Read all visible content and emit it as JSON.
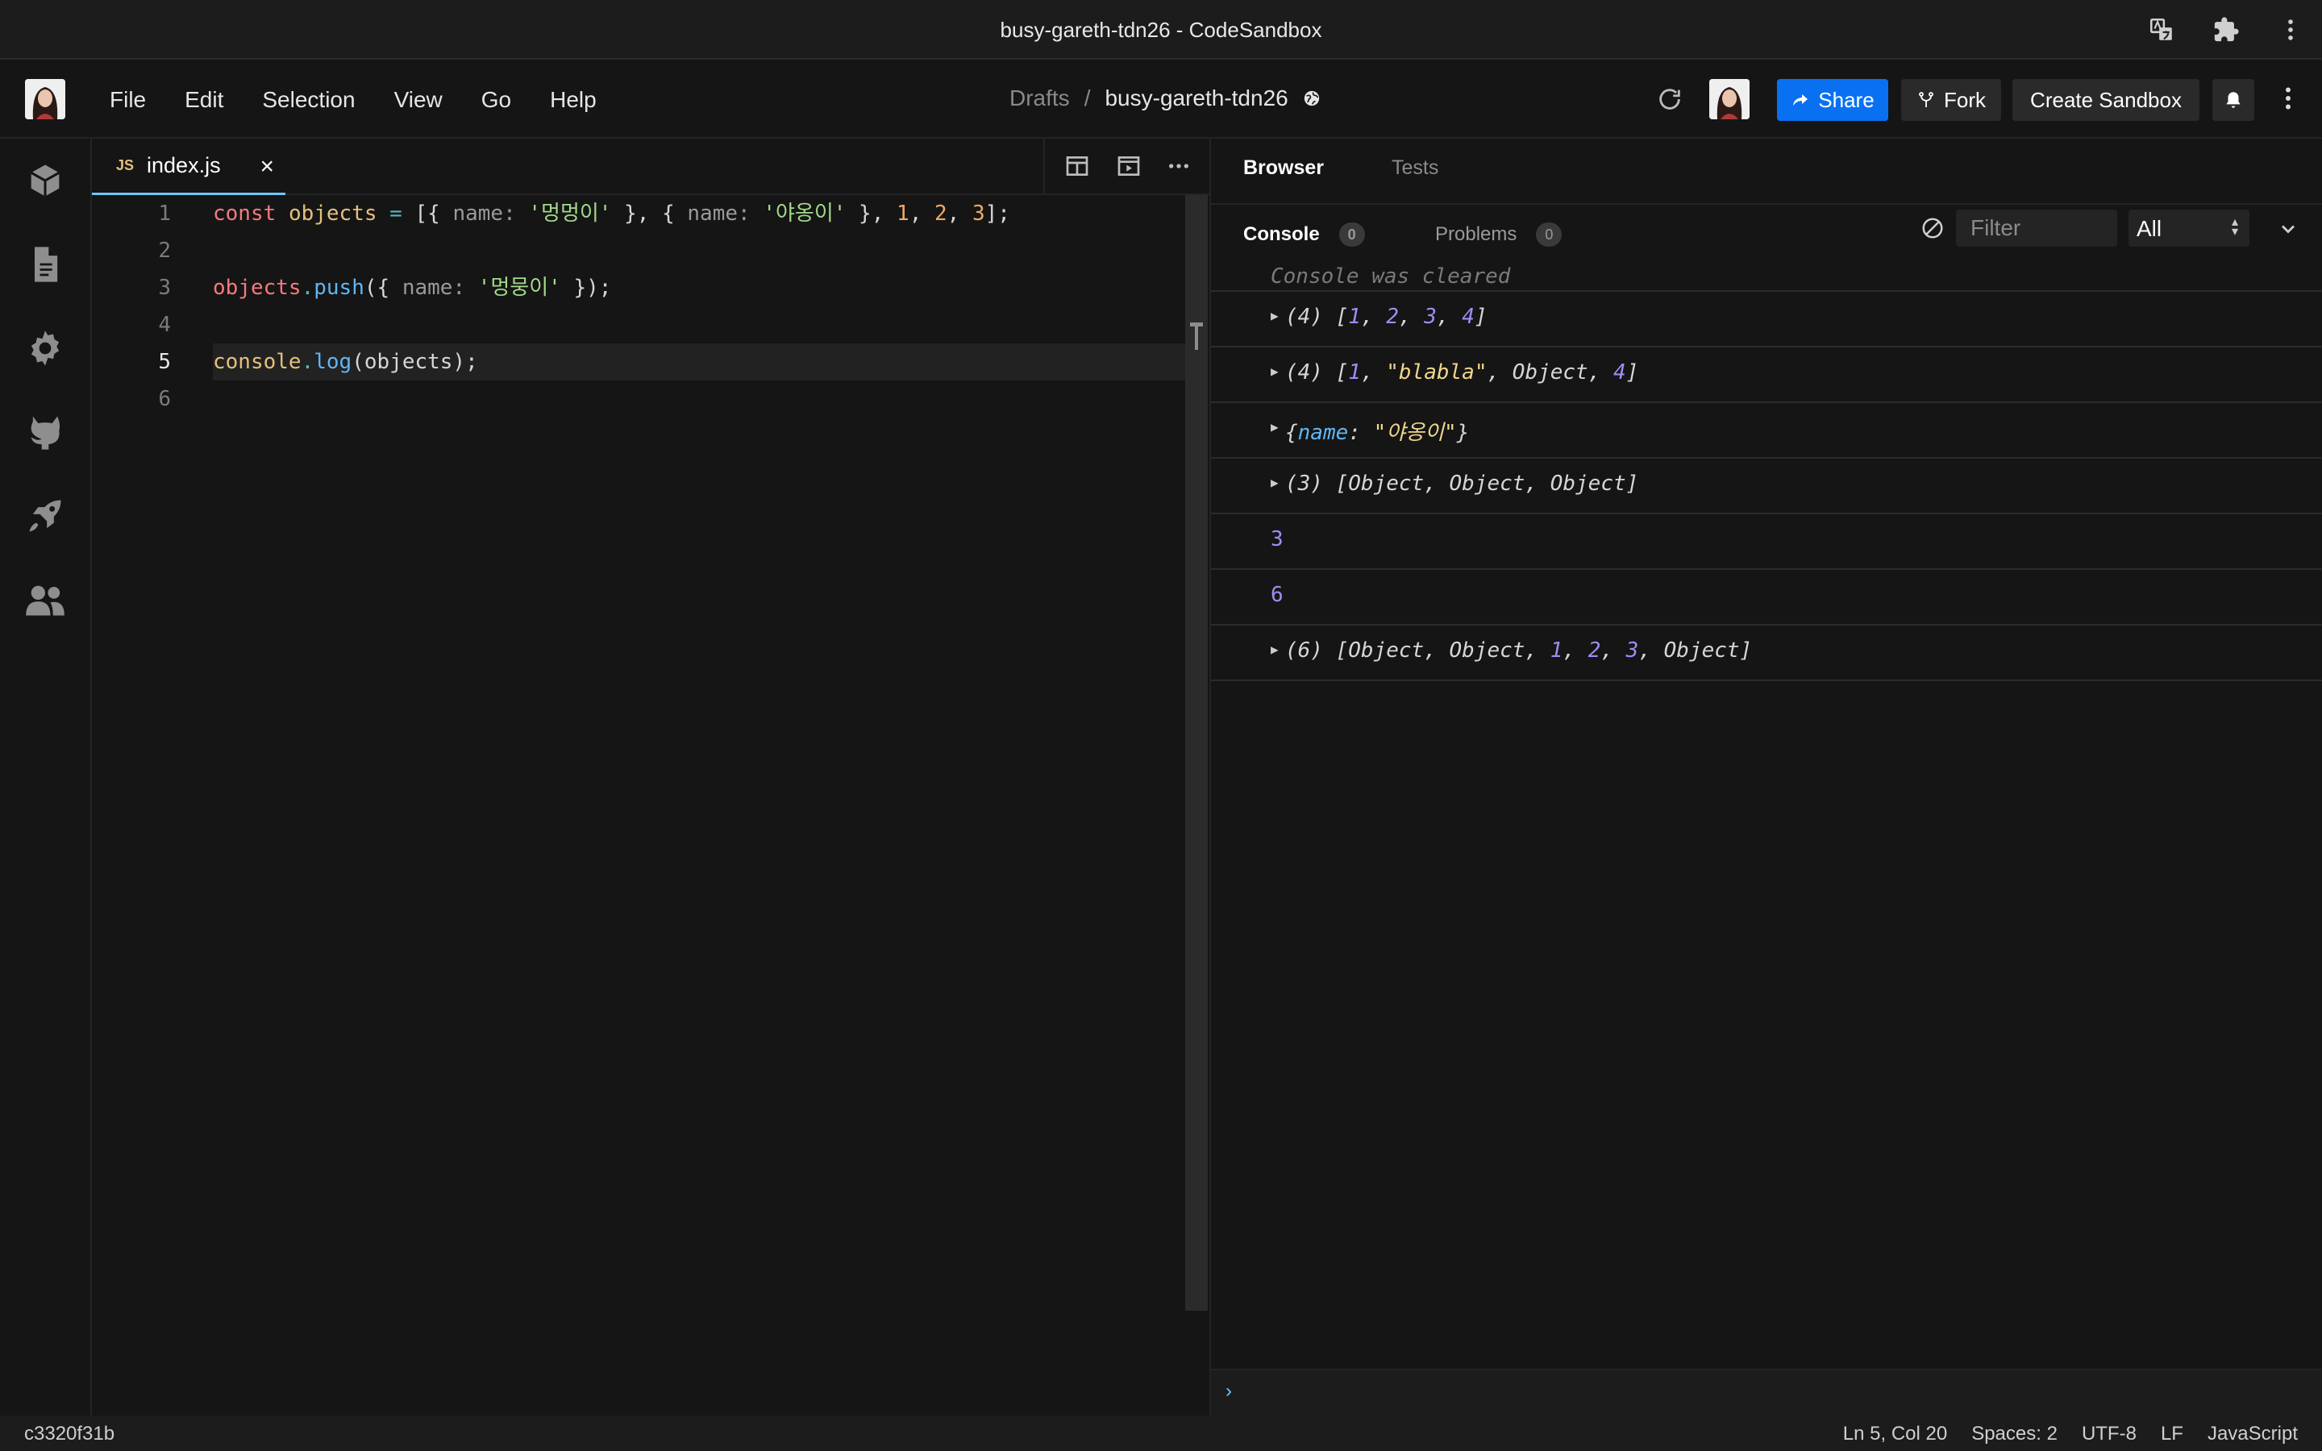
{
  "window": {
    "title": "busy-gareth-tdn26 - CodeSandbox"
  },
  "menu": [
    "File",
    "Edit",
    "Selection",
    "View",
    "Go",
    "Help"
  ],
  "breadcrumb": {
    "folder": "Drafts",
    "separator": "/",
    "name": "busy-gareth-tdn26"
  },
  "header": {
    "share_label": "Share",
    "fork_label": "Fork",
    "create_label": "Create Sandbox"
  },
  "activity": [
    "cube-icon",
    "file-icon",
    "gear-icon",
    "github-icon",
    "rocket-icon",
    "users-icon"
  ],
  "editor": {
    "tab": {
      "badge": "JS",
      "filename": "index.js",
      "close": "×"
    },
    "line_numbers": [
      "1",
      "2",
      "3",
      "4",
      "5",
      "6"
    ],
    "current_line": 5,
    "lines": [
      [
        {
          "t": "const",
          "c": "kw"
        },
        {
          "t": " "
        },
        {
          "t": "objects",
          "c": "var"
        },
        {
          "t": " "
        },
        {
          "t": "=",
          "c": "op"
        },
        {
          "t": " [{ "
        },
        {
          "t": "name:",
          "c": "prop"
        },
        {
          "t": " "
        },
        {
          "t": "'멍멍이'",
          "c": "str"
        },
        {
          "t": " }, { "
        },
        {
          "t": "name:",
          "c": "prop"
        },
        {
          "t": " "
        },
        {
          "t": "'야옹이'",
          "c": "str"
        },
        {
          "t": " }, "
        },
        {
          "t": "1",
          "c": "num"
        },
        {
          "t": ", "
        },
        {
          "t": "2",
          "c": "num"
        },
        {
          "t": ", "
        },
        {
          "t": "3",
          "c": "num"
        },
        {
          "t": "];"
        }
      ],
      [],
      [
        {
          "t": "objects",
          "c": "obj"
        },
        {
          "t": ".",
          "c": "op"
        },
        {
          "t": "push",
          "c": "fn"
        },
        {
          "t": "({ "
        },
        {
          "t": "name:",
          "c": "prop"
        },
        {
          "t": " "
        },
        {
          "t": "'멍뭉이'",
          "c": "str"
        },
        {
          "t": " });"
        }
      ],
      [],
      [
        {
          "t": "console",
          "c": "var"
        },
        {
          "t": ".",
          "c": "op"
        },
        {
          "t": "log",
          "c": "fn"
        },
        {
          "t": "(objects);"
        }
      ],
      []
    ]
  },
  "panel": {
    "tabs": [
      "Browser",
      "Tests"
    ],
    "console_tab": {
      "label": "Console",
      "count": "0"
    },
    "problems_tab": {
      "label": "Problems",
      "count": "0"
    },
    "filter_placeholder": "Filter",
    "level": "All",
    "cleared_text": "Console was cleared",
    "entries": [
      {
        "expandable": true,
        "parts": [
          {
            "t": "(4) ["
          },
          {
            "t": "1",
            "c": "cnum"
          },
          {
            "t": ", "
          },
          {
            "t": "2",
            "c": "cnum"
          },
          {
            "t": ", "
          },
          {
            "t": "3",
            "c": "cnum"
          },
          {
            "t": ", "
          },
          {
            "t": "4",
            "c": "cnum"
          },
          {
            "t": "]"
          }
        ]
      },
      {
        "expandable": true,
        "parts": [
          {
            "t": "(4) ["
          },
          {
            "t": "1",
            "c": "cnum"
          },
          {
            "t": ", "
          },
          {
            "t": "\"blabla\"",
            "c": "cstr"
          },
          {
            "t": ", Object, "
          },
          {
            "t": "4",
            "c": "cnum"
          },
          {
            "t": "]"
          }
        ]
      },
      {
        "expandable": true,
        "parts": [
          {
            "t": "{"
          },
          {
            "t": "name",
            "c": "ckey"
          },
          {
            "t": ": "
          },
          {
            "t": "\"야옹이\"",
            "c": "cstr"
          },
          {
            "t": "}"
          }
        ]
      },
      {
        "expandable": true,
        "parts": [
          {
            "t": "(3) [Object, Object, Object]"
          }
        ]
      },
      {
        "expandable": false,
        "parts": [
          {
            "t": "3",
            "c": "cnum"
          }
        ]
      },
      {
        "expandable": false,
        "parts": [
          {
            "t": "6",
            "c": "cnum"
          }
        ]
      },
      {
        "expandable": true,
        "parts": [
          {
            "t": "(6) [Object, Object, "
          },
          {
            "t": "1",
            "c": "cnum"
          },
          {
            "t": ", "
          },
          {
            "t": "2",
            "c": "cnum"
          },
          {
            "t": ", "
          },
          {
            "t": "3",
            "c": "cnum"
          },
          {
            "t": ", Object]"
          }
        ]
      }
    ],
    "prompt": "›"
  },
  "status": {
    "hash": "c3320f31b",
    "position": "Ln 5, Col 20",
    "spaces": "Spaces: 2",
    "encoding": "UTF-8",
    "eol": "LF",
    "language": "JavaScript"
  },
  "colors": {
    "accent": "#0971f1",
    "tab_underline": "#6cc7f6"
  }
}
